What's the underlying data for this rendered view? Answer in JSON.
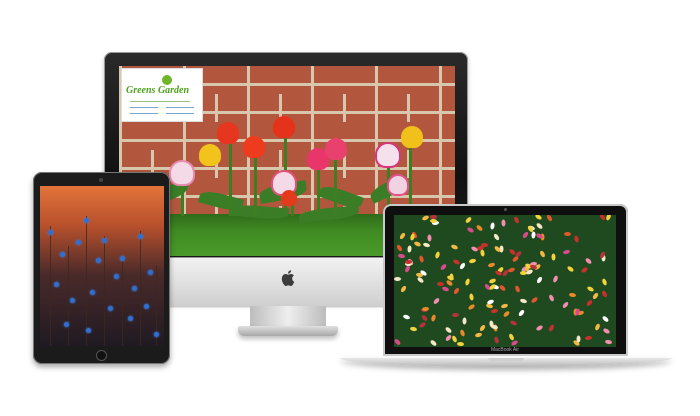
{
  "imac": {
    "logo": {
      "brand": "Greens Garden"
    },
    "apple_glyph": ""
  },
  "macbook": {
    "label": "MacBook Air"
  },
  "colors": {
    "brick": "#b2573d",
    "mortar": "#d9c7ad",
    "grass": "#3f8a22",
    "logo_green": "#4ea31b",
    "sunset": "#e2733a",
    "cornflower": "#2e6fd1"
  }
}
